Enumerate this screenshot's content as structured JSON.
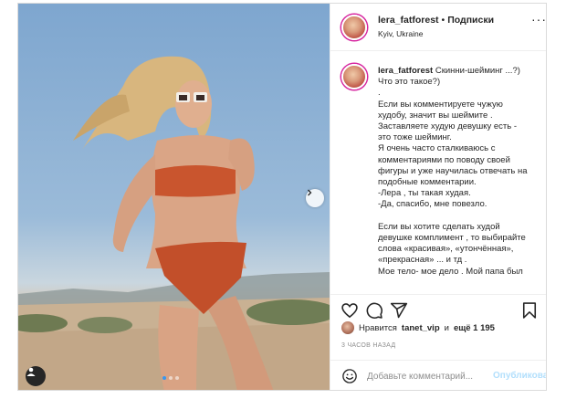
{
  "post": {
    "username": "lera_fatforest",
    "separator": "•",
    "follow_label": "Подписки",
    "location": "Kyiv, Ukraine",
    "more_label": "···"
  },
  "caption": {
    "username": "lera_fatforest",
    "lines": [
      "Скинни-шейминг ...?)",
      "Что это такое?)",
      ".",
      "Если вы комментируете чужую",
      "худобу, значит вы шеймите .",
      "Заставляете худую девушку есть -",
      "это тоже шейминг.",
      "Я очень часто сталкиваюсь с",
      "комментариями по поводу своей",
      "фигуры и уже научилась отвечать на",
      "подобные комментарии.",
      "-Лера , ты такая худая.",
      "-Да, спасибо, мне повезло.",
      "",
      "Если вы хотите сделать худой",
      "девушке комплимент , то выбирайте",
      "слова «красивая», «утончённая»,",
      "«прекрасная» ... и тд .",
      "Мое тело- мое дело . Мой папа был"
    ]
  },
  "likes": {
    "prefix": "Нравится",
    "user": "tanet_vip",
    "middle": "и",
    "count": "ещё 1 195"
  },
  "time_ago": "3 ЧАСОВ НАЗАД",
  "comment": {
    "placeholder": "Добавьте комментарий...",
    "publish_label": "Опубликовать"
  },
  "carousel": {
    "total": 3,
    "active": 1
  },
  "colors": {
    "link_disabled": "#b2dffc",
    "active_dot": "#3897f0",
    "text": "#262626",
    "muted": "#8e8e8e"
  }
}
